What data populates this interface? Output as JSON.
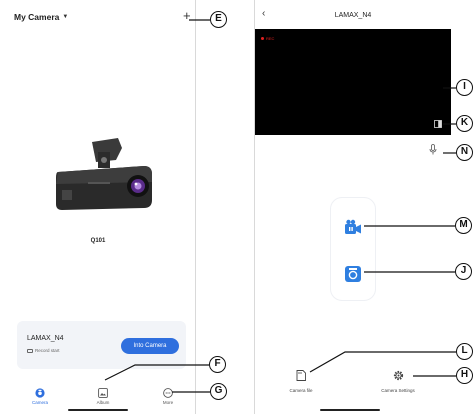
{
  "left_screen": {
    "header_title": "My Camera",
    "add_icon": "plus-icon",
    "device_name": "Q101",
    "card": {
      "name": "LAMAX_N4",
      "status": "Record start",
      "into_button": "Into Camera"
    },
    "nav": [
      {
        "label": "Camera",
        "icon": "camera-icon",
        "active": true
      },
      {
        "label": "Album",
        "icon": "album-icon",
        "active": false
      },
      {
        "label": "More",
        "icon": "more-icon",
        "active": false
      }
    ]
  },
  "right_screen": {
    "title": "LAMAX_N4",
    "rec_label": "REC",
    "bottom_buttons": [
      {
        "label": "Camera file",
        "icon": "sd-card-icon"
      },
      {
        "label": "Camera Settings",
        "icon": "gear-icon"
      }
    ]
  },
  "callouts": {
    "E": "E",
    "F": "F",
    "G": "G",
    "I": "I",
    "K": "K",
    "N": "N",
    "M": "M",
    "J": "J",
    "L": "L",
    "H": "H"
  },
  "colors": {
    "accent": "#2f6fde",
    "video_bg": "#000000",
    "rec": "#e02020",
    "card_bg": "#f2f4f8"
  }
}
